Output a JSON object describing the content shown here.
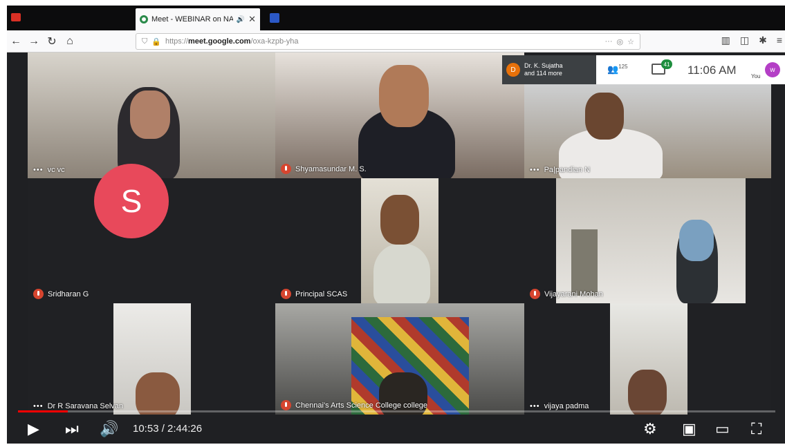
{
  "browser": {
    "tab_title": "Meet - WEBINAR on NAAC",
    "url_host": "meet.google.com",
    "url_prefix": "https://",
    "url_path": "/oxa-kzpb-yha",
    "more": "···"
  },
  "meet": {
    "presenter_initial": "D",
    "presenter_line1": "Dr. K. Sujatha",
    "presenter_line2": "and 114 more",
    "people_count": "125",
    "chat_badge": "41",
    "time": "11:06 AM",
    "you_label": "You",
    "user_initial": "w"
  },
  "tiles": [
    {
      "name": "vc vc",
      "muted": false
    },
    {
      "name": "Shyamasundar M. S.",
      "muted": true
    },
    {
      "name": "Pa|pandian N",
      "muted": false
    },
    {
      "name": "Sridharan G",
      "muted": true,
      "initial": "S"
    },
    {
      "name": "Principal SCAS",
      "muted": true
    },
    {
      "name": "Vijayarani Mohan",
      "muted": true
    },
    {
      "name": "Dr R Saravana Selvan",
      "muted": false
    },
    {
      "name": "Chennai's Arts Science College college",
      "muted": true
    },
    {
      "name": "vijaya padma",
      "muted": false
    }
  ],
  "player": {
    "time_display": "10:53 / 2:44:26",
    "progress_fraction": 0.066
  },
  "colors": {
    "progress": "#ff0000",
    "mute_badge": "#d6452f",
    "avatar_s": "#e8495b"
  }
}
